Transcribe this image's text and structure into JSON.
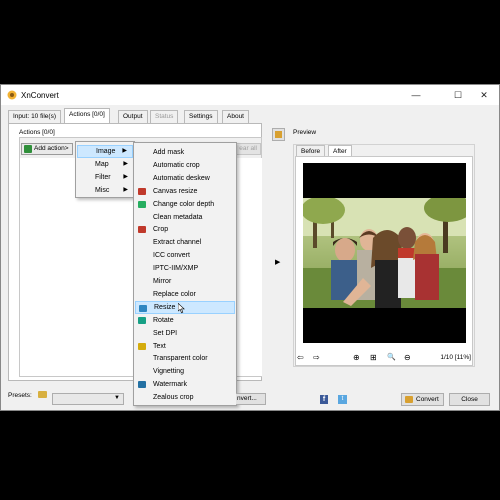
{
  "window": {
    "title": "XnConvert",
    "min_glyph": "—",
    "max_glyph": "☐",
    "close_glyph": "✕"
  },
  "tabs": [
    {
      "label": "Input: 10 file(s)"
    },
    {
      "label": "Actions [0/0]"
    },
    {
      "label": "Output"
    },
    {
      "label": "Status"
    },
    {
      "label": "Settings"
    },
    {
      "label": "About"
    }
  ],
  "actions": {
    "group_label": "Actions [0/0]",
    "add_action_label": "Add action>",
    "clear_all_label": "ear all"
  },
  "menu_main": {
    "items": [
      {
        "label": "Image",
        "arrow": "▶"
      },
      {
        "label": "Map",
        "arrow": "▶"
      },
      {
        "label": "Filter",
        "arrow": "▶"
      },
      {
        "label": "Misc",
        "arrow": "▶"
      }
    ],
    "highlighted": "Image"
  },
  "menu_image": {
    "items": [
      {
        "label": "Add mask",
        "icon": "none"
      },
      {
        "label": "Automatic crop",
        "icon": "none"
      },
      {
        "label": "Automatic deskew",
        "icon": "none"
      },
      {
        "label": "Canvas resize",
        "icon": "canvas-icon"
      },
      {
        "label": "Change color depth",
        "icon": "color-depth-icon"
      },
      {
        "label": "Clean metadata",
        "icon": "none"
      },
      {
        "label": "Crop",
        "icon": "crop-icon"
      },
      {
        "label": "Extract channel",
        "icon": "none"
      },
      {
        "label": "ICC convert",
        "icon": "none"
      },
      {
        "label": "IPTC-IIM/XMP",
        "icon": "none"
      },
      {
        "label": "Mirror",
        "icon": "none"
      },
      {
        "label": "Replace color",
        "icon": "none"
      },
      {
        "label": "Resize",
        "icon": "resize-icon"
      },
      {
        "label": "Rotate",
        "icon": "rotate-icon"
      },
      {
        "label": "Set DPI",
        "icon": "none"
      },
      {
        "label": "Text",
        "icon": "text-icon"
      },
      {
        "label": "Transparent color",
        "icon": "none"
      },
      {
        "label": "Vignetting",
        "icon": "none"
      },
      {
        "label": "Watermark",
        "icon": "watermark-icon"
      },
      {
        "label": "Zealous crop",
        "icon": "none"
      }
    ],
    "highlighted": "Resize",
    "colors": {
      "canvas-icon": "#c0392b",
      "color-depth-icon": "#27ae60",
      "crop-icon": "#c0392b",
      "resize-icon": "#2e86c1",
      "rotate-icon": "#16a085",
      "text-icon": "#d4ac0d",
      "watermark-icon": "#2471a3"
    }
  },
  "preview": {
    "label": "Preview",
    "tab_before": "Before",
    "tab_after": "After",
    "page_info": "1/10 [11%]",
    "tool_prev": "⇦",
    "tool_next": "⇨",
    "tool_zoom_in": "⊕",
    "tool_fit": "⊞",
    "tool_zoom": "🔍",
    "tool_zoom_out": "⊖",
    "side_arrow": "▶"
  },
  "bottom": {
    "presets_label": "Presets:",
    "convert_partial": "nvert...",
    "facebook_glyph": "f",
    "twitter_glyph": "t",
    "convert_label": "Convert",
    "close_label": "Close"
  },
  "colors": {
    "highlight": "#cde8ff",
    "highlight_border": "#99d1ff"
  }
}
